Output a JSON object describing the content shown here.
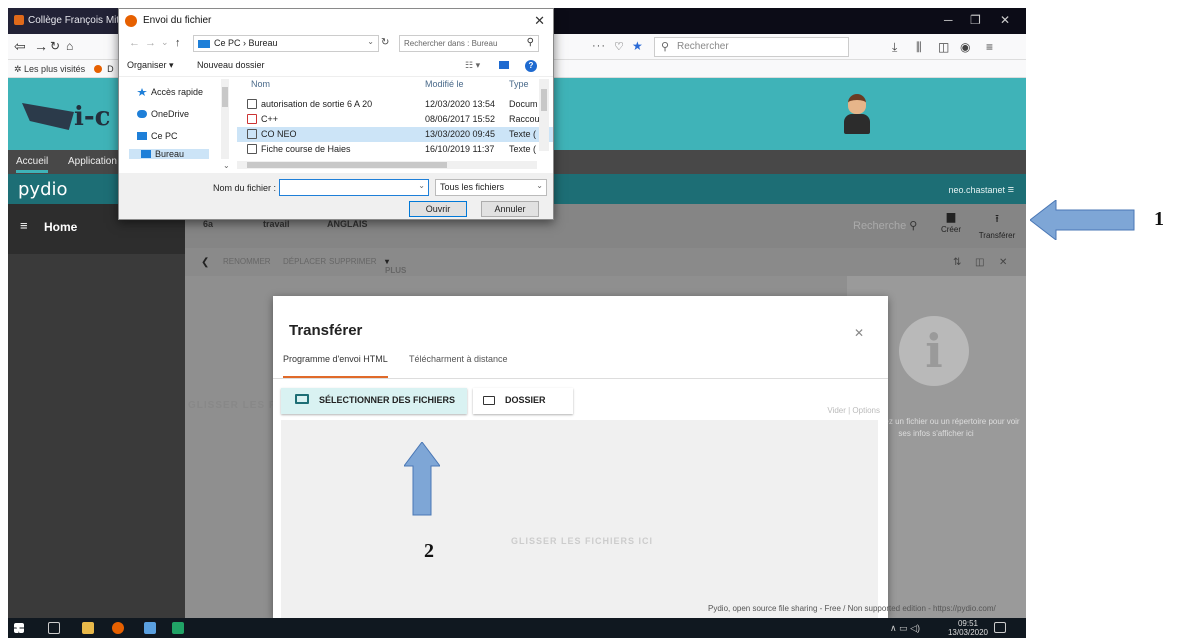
{
  "browser": {
    "tab_title": "Collège François Mitte",
    "url_dots": "···",
    "search_placeholder": "Rechercher",
    "bookmarks_label": "Les plus visités",
    "bookmarks_second": "D"
  },
  "site": {
    "logo_text": "i-c",
    "nav": [
      "Accueil",
      "Application"
    ]
  },
  "pydio": {
    "logo": "pydio",
    "user": "neo.chastanet",
    "home": "Home",
    "crumbs": [
      "6a",
      "travail",
      "ANGLAIS"
    ],
    "search_label": "Recherche",
    "create_label": "Créer",
    "transfer_label": "Transférer",
    "actions": [
      "RENOMMER",
      "DÉPLACER",
      "SUPPRIMER",
      "PLUS"
    ],
    "info_text": "électionnez un fichier ou un répertoire pour voir ses infos s'afficher ici",
    "left_drop_text": "GLISSER LES FI",
    "footer": "Pydio, open source file sharing - Free / Non supported edition - https://pydio.com/"
  },
  "modal": {
    "title": "Transférer",
    "tabs": [
      "Programme d'envoi HTML",
      "Télécharment à distance"
    ],
    "select_files": "SÉLECTIONNER DES FICHIERS",
    "folder": "DOSSIER",
    "clear": "Vider | Options",
    "drop_text": "GLISSER LES FICHIERS ICI"
  },
  "dialog": {
    "title": "Envoi du fichier",
    "path": "Ce PC › Bureau",
    "search_placeholder": "Rechercher dans : Bureau",
    "organize": "Organiser ▾",
    "new_folder": "Nouveau dossier",
    "nav_items": [
      "Accès rapide",
      "OneDrive",
      "Ce PC",
      "Bureau"
    ],
    "columns": [
      "Nom",
      "Modifié le",
      "Type"
    ],
    "files": [
      {
        "name": "autorisation de sortie 6 A 20",
        "date": "12/03/2020 13:54",
        "type": "Docum"
      },
      {
        "name": "C++",
        "date": "08/06/2017 15:52",
        "type": "Raccou"
      },
      {
        "name": "CO NEO",
        "date": "13/03/2020 09:45",
        "type": "Texte ("
      },
      {
        "name": "Fiche course de Haies",
        "date": "16/10/2019 11:37",
        "type": "Texte ("
      }
    ],
    "filename_label": "Nom du fichier :",
    "filename_value": "",
    "filetype": "Tous les fichiers",
    "open_btn": "Ouvrir",
    "cancel_btn": "Annuler"
  },
  "taskbar": {
    "time": "09:51",
    "date": "13/03/2020"
  },
  "annotations": {
    "label1": "1",
    "label2": "2",
    "arrow_color": "#7ea6d6"
  }
}
